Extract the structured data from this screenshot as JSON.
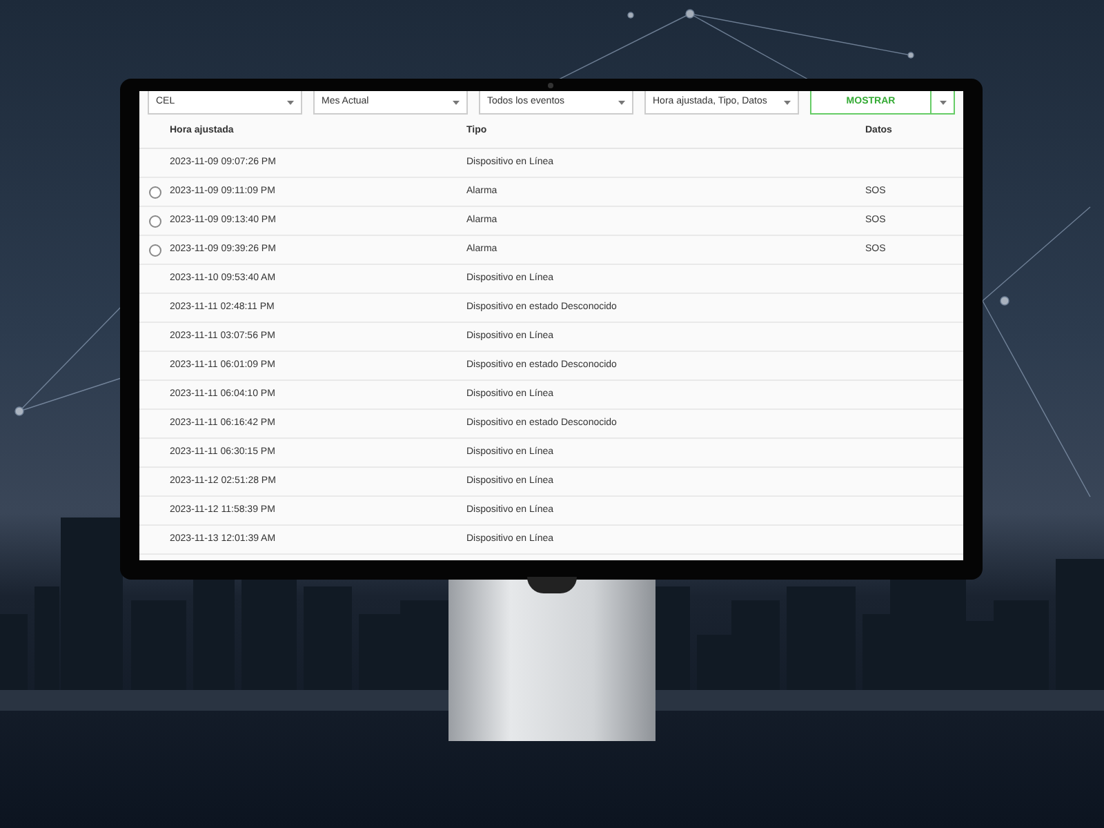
{
  "filters": [
    {
      "value": "CEL"
    },
    {
      "value": "Mes Actual"
    },
    {
      "value": "Todos los eventos"
    },
    {
      "value": "Hora ajustada, Tipo, Datos"
    }
  ],
  "show_button": {
    "label": "MOSTRAR"
  },
  "table": {
    "columns": [
      "Hora ajustada",
      "Tipo",
      "Datos"
    ],
    "rows": [
      {
        "kind": "plain",
        "cells": [
          "2023-11-09 09:07:26 PM",
          "Dispositivo en Línea"
        ]
      },
      {
        "kind": "radio",
        "selected": false,
        "cells": [
          "2023-11-09 09:11:09 PM",
          "Alarma",
          "SOS"
        ]
      },
      {
        "kind": "radio",
        "selected": false,
        "cells": [
          "2023-11-09 09:13:40 PM",
          "Alarma",
          "SOS"
        ]
      },
      {
        "kind": "radio",
        "selected": false,
        "cells": [
          "2023-11-09 09:39:26 PM",
          "Alarma",
          "SOS"
        ]
      },
      {
        "kind": "plain",
        "cells": [
          "2023-11-10 09:53:40 AM",
          "Dispositivo en Línea"
        ]
      },
      {
        "kind": "plain",
        "cells": [
          "2023-11-11 02:48:11 PM",
          "Dispositivo en estado Desconocido"
        ]
      },
      {
        "kind": "plain",
        "cells": [
          "2023-11-11 03:07:56 PM",
          "Dispositivo en Línea"
        ]
      },
      {
        "kind": "plain",
        "cells": [
          "2023-11-11 06:01:09 PM",
          "Dispositivo en estado Desconocido"
        ]
      },
      {
        "kind": "plain",
        "cells": [
          "2023-11-11 06:04:10 PM",
          "Dispositivo en Línea"
        ]
      },
      {
        "kind": "plain",
        "cells": [
          "2023-11-11 06:16:42 PM",
          "Dispositivo en estado Desconocido"
        ]
      },
      {
        "kind": "plain",
        "cells": [
          "2023-11-11 06:30:15 PM",
          "Dispositivo en Línea"
        ]
      },
      {
        "kind": "plain",
        "cells": [
          "2023-11-12 02:51:28 PM",
          "Dispositivo en Línea"
        ]
      },
      {
        "kind": "plain",
        "cells": [
          "2023-11-12 11:58:39 PM",
          "Dispositivo en Línea"
        ]
      },
      {
        "kind": "plain",
        "cells": [
          "2023-11-13 12:01:39 AM",
          "Dispositivo en Línea"
        ]
      }
    ]
  }
}
